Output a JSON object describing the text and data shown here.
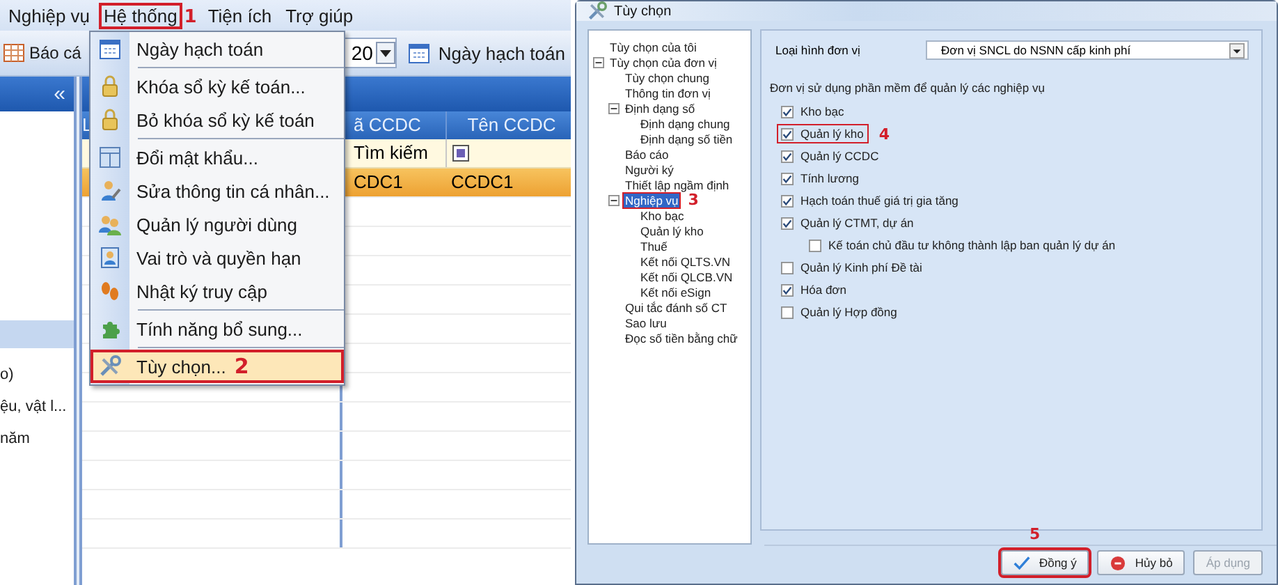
{
  "main_window": {
    "menu_bar": [
      {
        "label": "Nghiệp vụ",
        "selected": false
      },
      {
        "label": "Hệ thống",
        "selected": true,
        "annotation": "1"
      },
      {
        "label": "Tiện ích",
        "selected": false
      },
      {
        "label": "Trợ giúp",
        "selected": false
      }
    ],
    "toolbar": {
      "report_button": "Báo cá",
      "period_combo": "20",
      "date_button": "Ngày hạch toán"
    },
    "left_pane": {
      "collapse_glyph": "«",
      "items": [
        "o)",
        "ệu, vật l...",
        "năm"
      ]
    },
    "grid": {
      "columns": [
        "L",
        "ã CCDC",
        "Tên CCDC"
      ],
      "filter_placeholder": "Tìm kiếm",
      "rows": [
        {
          "cells": [
            "",
            "CDC1",
            "CCDC1"
          ],
          "selected": true
        }
      ]
    },
    "system_menu": [
      {
        "label": "Ngày hạch toán",
        "selected": false,
        "separator_after": true
      },
      {
        "label": "Khóa sổ kỳ kế toán...",
        "selected": false,
        "separator_after": false
      },
      {
        "label": "Bỏ khóa sổ kỳ kế toán",
        "selected": false,
        "separator_after": true
      },
      {
        "label": "Đổi mật khẩu...",
        "selected": false,
        "separator_after": false
      },
      {
        "label": "Sửa thông tin cá nhân...",
        "selected": false,
        "separator_after": false
      },
      {
        "label": "Quản lý người dùng",
        "selected": false,
        "separator_after": false
      },
      {
        "label": "Vai trò và quyền hạn",
        "selected": false,
        "separator_after": false
      },
      {
        "label": "Nhật ký truy cập",
        "selected": false,
        "separator_after": true
      },
      {
        "label": "Tính năng bổ sung...",
        "selected": false,
        "separator_after": true
      },
      {
        "label": "Tùy chọn...",
        "selected": true,
        "separator_after": false,
        "annotation": "2"
      }
    ]
  },
  "dialog": {
    "title": "Tùy chọn",
    "tree": [
      {
        "label": "Tùy chọn của tôi",
        "selected": false
      },
      {
        "label": "Tùy chọn của đơn vị",
        "selected": false,
        "expanded": true,
        "children": [
          {
            "label": "Tùy chọn chung",
            "selected": false
          },
          {
            "label": "Thông tin đơn vị",
            "selected": false
          },
          {
            "label": "Định dạng số",
            "selected": false,
            "expanded": true,
            "children": [
              {
                "label": "Định dạng chung",
                "selected": false
              },
              {
                "label": "Định dạng số tiền",
                "selected": false
              }
            ]
          },
          {
            "label": "Báo cáo",
            "selected": false
          },
          {
            "label": "Người ký",
            "selected": false
          },
          {
            "label": "Thiết lập ngầm định",
            "selected": false
          },
          {
            "label": "Nghiệp vụ",
            "selected": true,
            "expanded": true,
            "annotation": "3",
            "children": [
              {
                "label": "Kho bạc",
                "selected": false
              },
              {
                "label": "Quản lý kho",
                "selected": false
              },
              {
                "label": "Thuế",
                "selected": false
              },
              {
                "label": "Kết nối QLTS.VN",
                "selected": false
              },
              {
                "label": "Kết nối QLCB.VN",
                "selected": false
              },
              {
                "label": "Kết nối eSign",
                "selected": false
              }
            ]
          },
          {
            "label": "Qui tắc đánh số CT",
            "selected": false
          },
          {
            "label": "Sao lưu",
            "selected": false
          },
          {
            "label": "Đọc số tiền bằng chữ",
            "selected": false
          }
        ]
      }
    ],
    "unit_type": {
      "label": "Loại hình đơn vị",
      "value": "Đơn vị SNCL do NSNN cấp kinh phí"
    },
    "modules_heading": "Đơn vị sử dụng phần mềm để quản lý các nghiệp vụ",
    "modules": [
      {
        "label": "Kho bạc",
        "checked": true
      },
      {
        "label": "Quản lý kho",
        "checked": true,
        "annotation": "4"
      },
      {
        "label": "Quản lý CCDC",
        "checked": true
      },
      {
        "label": "Tính lương",
        "checked": true
      },
      {
        "label": "Hạch toán thuế giá trị gia tăng",
        "checked": true
      },
      {
        "label": "Quản lý CTMT, dự án",
        "checked": true,
        "children": [
          {
            "label": "Kế toán chủ đầu tư không thành lập ban quản lý dự án",
            "checked": false
          }
        ]
      },
      {
        "label": "Quản lý Kinh phí Đề tài",
        "checked": false
      },
      {
        "label": "Hóa đơn",
        "checked": true
      },
      {
        "label": "Quản lý Hợp đồng",
        "checked": false
      }
    ],
    "buttons": [
      {
        "label": "Đồng ý",
        "kind": "ok",
        "disabled": false,
        "annotation": "5"
      },
      {
        "label": "Hủy bỏ",
        "kind": "cancel",
        "disabled": false
      },
      {
        "label": "Áp dụng",
        "kind": "apply",
        "disabled": true
      }
    ]
  }
}
